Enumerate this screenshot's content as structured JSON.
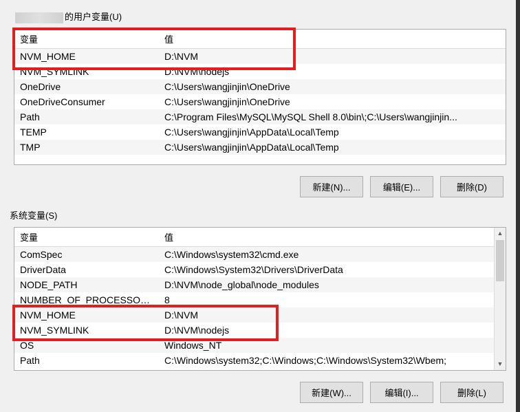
{
  "user_section": {
    "label_suffix": "的用户变量(U)",
    "columns": {
      "variable": "变量",
      "value": "值"
    },
    "rows": [
      {
        "name": "NVM_HOME",
        "value": "D:\\NVM"
      },
      {
        "name": "NVM_SYMLINK",
        "value": "D:\\NVM\\nodejs"
      },
      {
        "name": "OneDrive",
        "value": "C:\\Users\\wangjinjin\\OneDrive"
      },
      {
        "name": "OneDriveConsumer",
        "value": "C:\\Users\\wangjinjin\\OneDrive"
      },
      {
        "name": "Path",
        "value": "C:\\Program Files\\MySQL\\MySQL Shell 8.0\\bin\\;C:\\Users\\wangjinjin..."
      },
      {
        "name": "TEMP",
        "value": "C:\\Users\\wangjinjin\\AppData\\Local\\Temp"
      },
      {
        "name": "TMP",
        "value": "C:\\Users\\wangjinjin\\AppData\\Local\\Temp"
      }
    ],
    "buttons": {
      "new": "新建(N)...",
      "edit": "编辑(E)...",
      "delete": "删除(D)"
    }
  },
  "system_section": {
    "label": "系统变量(S)",
    "columns": {
      "variable": "变量",
      "value": "值"
    },
    "rows": [
      {
        "name": "ComSpec",
        "value": "C:\\Windows\\system32\\cmd.exe"
      },
      {
        "name": "DriverData",
        "value": "C:\\Windows\\System32\\Drivers\\DriverData"
      },
      {
        "name": "NODE_PATH",
        "value": "D:\\NVM\\node_global\\node_modules"
      },
      {
        "name": "NUMBER_OF_PROCESSORS",
        "value": "8"
      },
      {
        "name": "NVM_HOME",
        "value": "D:\\NVM"
      },
      {
        "name": "NVM_SYMLINK",
        "value": "D:\\NVM\\nodejs"
      },
      {
        "name": "OS",
        "value": "Windows_NT"
      },
      {
        "name": "Path",
        "value": "C:\\Windows\\system32;C:\\Windows;C:\\Windows\\System32\\Wbem;"
      }
    ],
    "buttons": {
      "new": "新建(W)...",
      "edit": "编辑(I)...",
      "delete": "删除(L)"
    }
  }
}
